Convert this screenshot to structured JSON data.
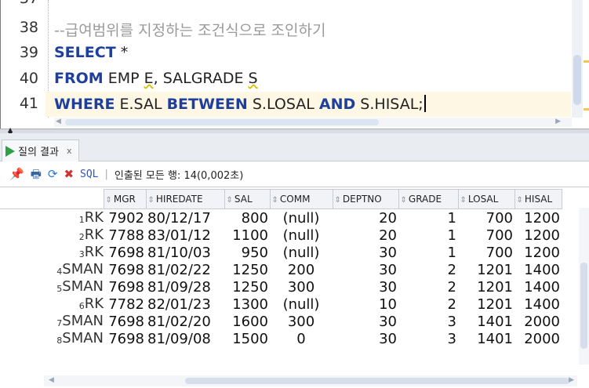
{
  "editor": {
    "top_partial_line": "37",
    "lines": [
      {
        "n": "38",
        "comment": "--급여범위를 지정하는 조건식으로 조인하기"
      },
      {
        "n": "39",
        "kw1": "SELECT",
        "rest1": " *"
      },
      {
        "n": "40",
        "kw1": "FROM",
        "rest1": " EMP ",
        "sq1": "E",
        "rest2": ", SALGRADE ",
        "sq2": "S"
      },
      {
        "n": "41",
        "kw1": "WHERE",
        "rest1": " E.SAL ",
        "kw2": "BETWEEN",
        "rest2": " S.LOSAL ",
        "kw3": "AND",
        "rest3": " S.HISAL;"
      }
    ]
  },
  "results": {
    "tab_label": "질의 결과",
    "tab_close": "x",
    "sql_label": "SQL",
    "separator": "|",
    "fetched_text": "인출된 모든 행: 14(0,002초)",
    "columns": [
      "MGR",
      "HIREDATE",
      "SAL",
      "COMM",
      "DEPTNO",
      "GRADE",
      "LOSAL",
      "HISAL"
    ],
    "rows": [
      {
        "rn": "1",
        "job": "RK",
        "cells": [
          "7902",
          "80/12/17",
          "800",
          "(null)",
          "20",
          "1",
          "700",
          "1200"
        ]
      },
      {
        "rn": "2",
        "job": "RK",
        "cells": [
          "7788",
          "83/01/12",
          "1100",
          "(null)",
          "20",
          "1",
          "700",
          "1200"
        ]
      },
      {
        "rn": "3",
        "job": "RK",
        "cells": [
          "7698",
          "81/10/03",
          "950",
          "(null)",
          "30",
          "1",
          "700",
          "1200"
        ]
      },
      {
        "rn": "4",
        "job": "SMAN",
        "cells": [
          "7698",
          "81/02/22",
          "1250",
          "200",
          "30",
          "2",
          "1201",
          "1400"
        ]
      },
      {
        "rn": "5",
        "job": "SMAN",
        "cells": [
          "7698",
          "81/09/28",
          "1250",
          "300",
          "30",
          "2",
          "1201",
          "1400"
        ]
      },
      {
        "rn": "6",
        "job": "RK",
        "cells": [
          "7782",
          "82/01/23",
          "1300",
          "(null)",
          "10",
          "2",
          "1201",
          "1400"
        ]
      },
      {
        "rn": "7",
        "job": "SMAN",
        "cells": [
          "7698",
          "81/02/20",
          "1600",
          "300",
          "30",
          "3",
          "1401",
          "2000"
        ]
      },
      {
        "rn": "8",
        "job": "SMAN",
        "cells": [
          "7698",
          "81/09/08",
          "1500",
          "0",
          "30",
          "3",
          "1401",
          "2000"
        ]
      }
    ]
  }
}
